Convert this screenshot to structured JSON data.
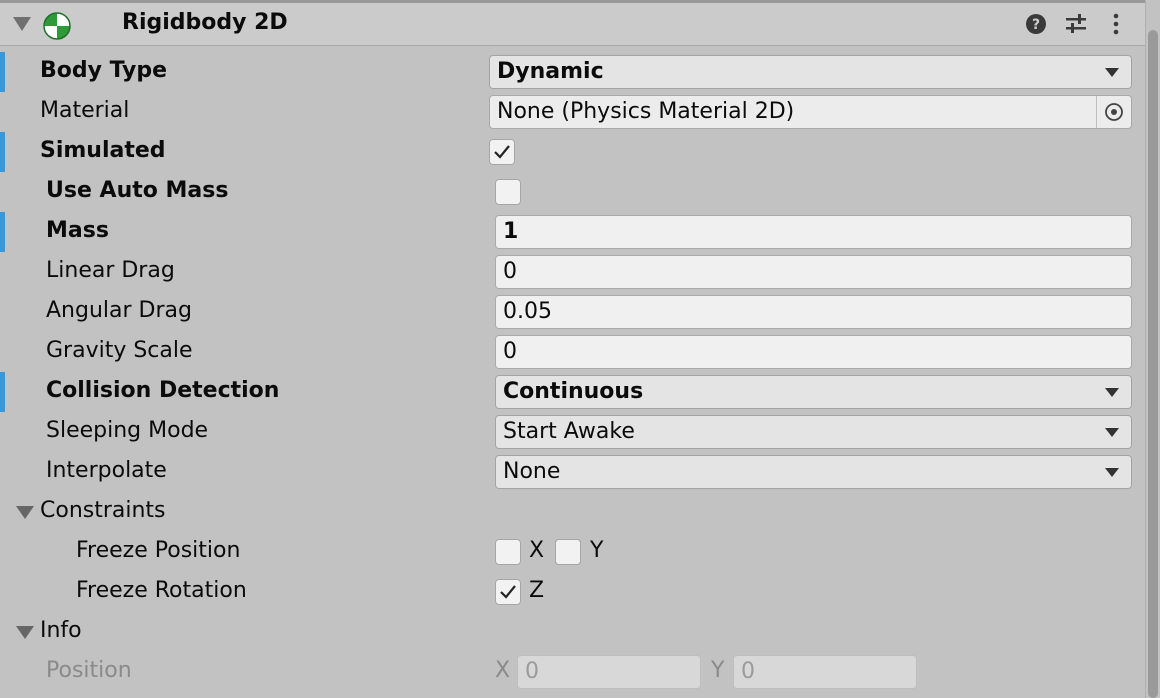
{
  "component": {
    "title": "Rigidbody 2D",
    "icons": [
      "component-physics-icon",
      "help-icon",
      "presets-icon",
      "more-menu-icon"
    ]
  },
  "properties": {
    "body_type": {
      "label": "Body Type",
      "value": "Dynamic"
    },
    "material": {
      "label": "Material",
      "value": "None (Physics Material 2D)"
    },
    "simulated": {
      "label": "Simulated",
      "checked": true
    },
    "use_auto_mass": {
      "label": "Use Auto Mass",
      "checked": false
    },
    "mass": {
      "label": "Mass",
      "value": "1"
    },
    "linear_drag": {
      "label": "Linear Drag",
      "value": "0"
    },
    "angular_drag": {
      "label": "Angular Drag",
      "value": "0.05"
    },
    "gravity_scale": {
      "label": "Gravity Scale",
      "value": "0"
    },
    "collision_detection": {
      "label": "Collision Detection",
      "value": "Continuous"
    },
    "sleeping_mode": {
      "label": "Sleeping Mode",
      "value": "Start Awake"
    },
    "interpolate": {
      "label": "Interpolate",
      "value": "None"
    }
  },
  "constraints": {
    "label": "Constraints",
    "freeze_position": {
      "label": "Freeze Position",
      "x_label": "X",
      "y_label": "Y",
      "x": false,
      "y": false
    },
    "freeze_rotation": {
      "label": "Freeze Rotation",
      "z_label": "Z",
      "z": true
    }
  },
  "info": {
    "label": "Info",
    "position": {
      "label": "Position",
      "x_label": "X",
      "x": "0",
      "y_label": "Y",
      "y": "0"
    }
  },
  "colors": {
    "accent_bar": "#3a97d8",
    "panel_bg": "#c2c2c2",
    "field_bg": "#f0f0f0"
  }
}
